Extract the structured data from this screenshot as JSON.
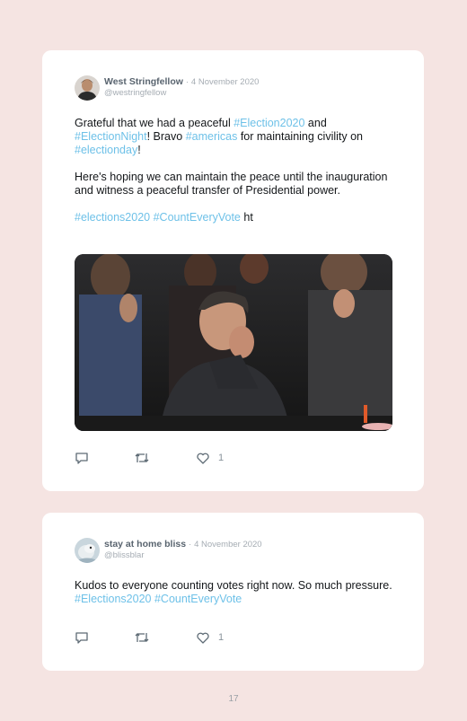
{
  "tweets": [
    {
      "author": "West Stringfellow",
      "separator": "·",
      "date": "4 November 2020",
      "handle": "@westringfellow",
      "p1": {
        "t1": "Grateful that we had a peaceful ",
        "h1": "#Election2020",
        "t2": " and ",
        "h2": "#ElectionNight",
        "t3": "! Bravo ",
        "h3": "#americas",
        "t4": " for maintaining civility on ",
        "h4": "#electionday",
        "t5": "!"
      },
      "p2": "Here's hoping we can maintain the peace until the inauguration and witness a peaceful transfer of Presidential power.",
      "p3": {
        "h1": "#elections2020",
        "t1": " ",
        "h2": "#CountEveryVote",
        "t2": " ht"
      },
      "like_count": "1",
      "icons": [
        "reply-icon",
        "retweet-icon",
        "heart-icon"
      ]
    },
    {
      "author": "stay at home bliss",
      "separator": "·",
      "date": "4 November 2020",
      "handle": "@blissblar",
      "p1": {
        "t1": "Kudos to everyone counting votes right now. So much pressure. ",
        "h1": "#Elections2020",
        "t2": " ",
        "h2": "#CountEveryVote"
      },
      "like_count": "1",
      "icons": [
        "reply-icon",
        "retweet-icon",
        "heart-icon"
      ]
    }
  ],
  "page_number": "17",
  "colors": {
    "page_background": "#f5e4e2",
    "card": "#ffffff",
    "hashtag": "#6ec1e8",
    "name": "#59646f",
    "muted": "#a5acb3"
  }
}
